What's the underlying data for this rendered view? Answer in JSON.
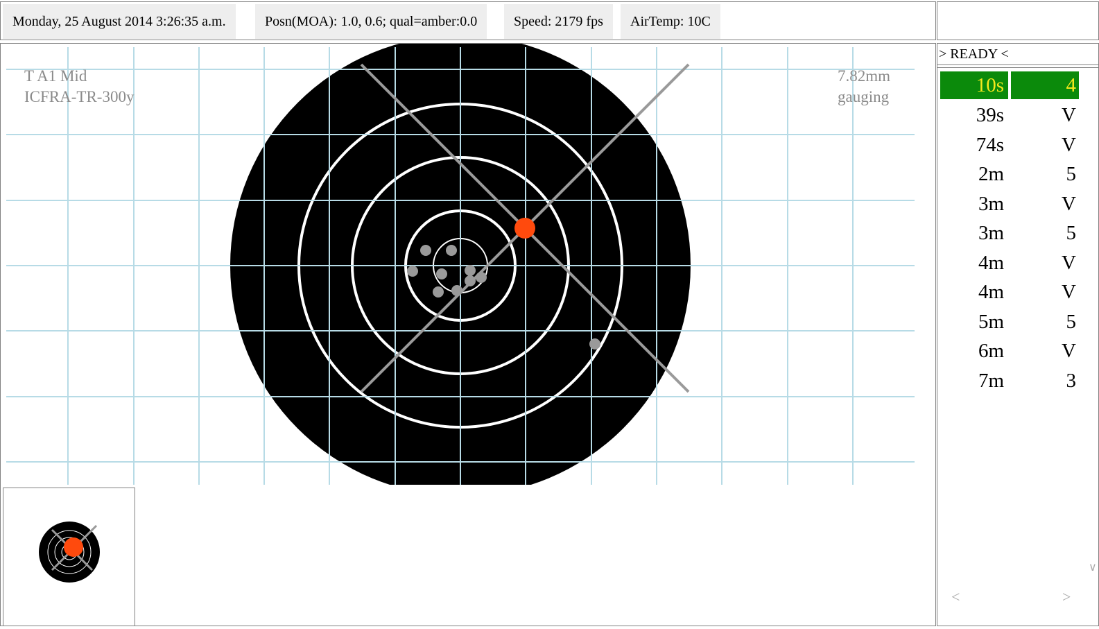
{
  "status_bar": {
    "datetime": "Monday, 25 August 2014 3:26:35 a.m.",
    "position": "Posn(MOA): 1.0, 0.6; qual=amber:0.0",
    "speed": "Speed: 2179 fps",
    "air_temp": "AirTemp: 10C"
  },
  "target": {
    "name_line1": "T A1 Mid",
    "name_line2": "ICFRA-TR-300y",
    "calibre_line1": "7.82mm",
    "calibre_line2": "gauging"
  },
  "side_panel": {
    "ready_label": "> READY <",
    "shots": [
      {
        "time": "10s",
        "score": "4",
        "active": true
      },
      {
        "time": "39s",
        "score": "V"
      },
      {
        "time": "74s",
        "score": "V"
      },
      {
        "time": "2m",
        "score": "5"
      },
      {
        "time": "3m",
        "score": "V"
      },
      {
        "time": "3m",
        "score": "5"
      },
      {
        "time": "4m",
        "score": "V"
      },
      {
        "time": "4m",
        "score": "V"
      },
      {
        "time": "5m",
        "score": "5"
      },
      {
        "time": "6m",
        "score": "V"
      },
      {
        "time": "7m",
        "score": "3"
      }
    ],
    "scroll_left": "<",
    "scroll_right": ">",
    "scroll_down": "∨"
  },
  "colors": {
    "target_black": "#000000",
    "grid_line": "#b7dbe6",
    "shot_latest": "#ff4a0d",
    "shot_previous": "#9a9a9a",
    "active_row_bg": "#0b8a0b",
    "active_row_text": "#f4e81c"
  }
}
